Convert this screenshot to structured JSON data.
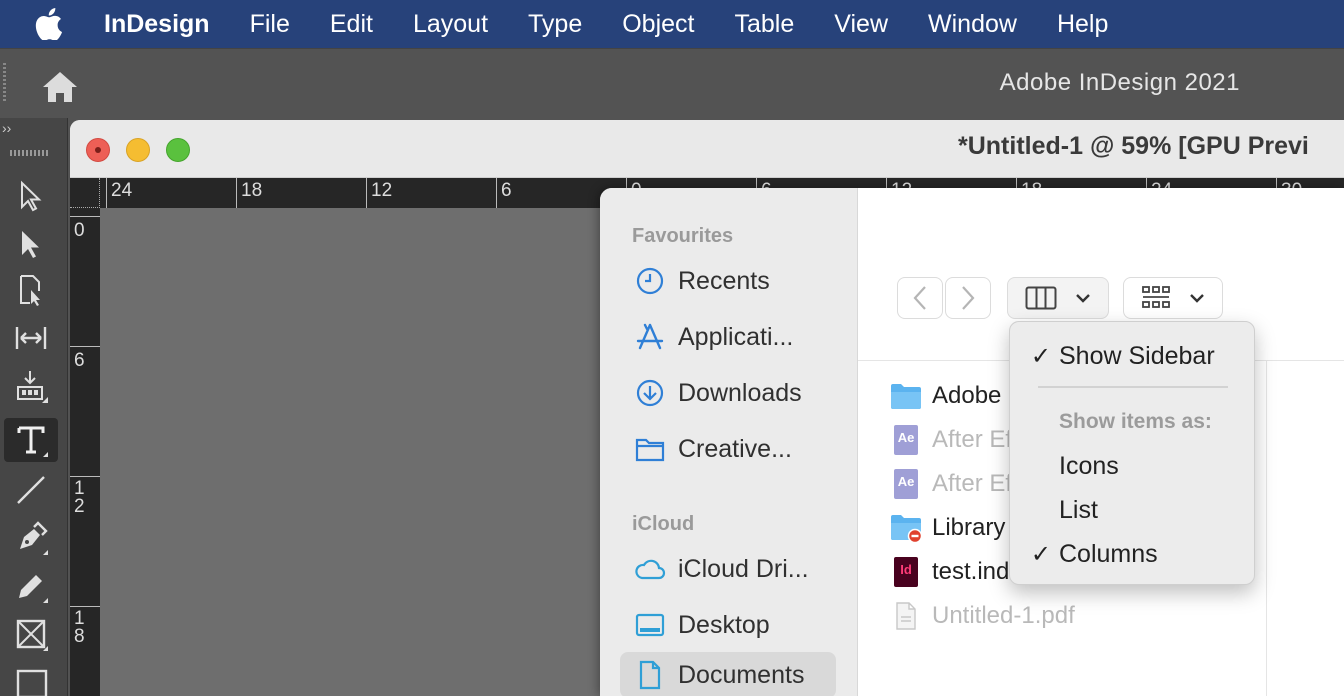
{
  "menubar": {
    "app_name": "InDesign",
    "items": [
      "File",
      "Edit",
      "Layout",
      "Type",
      "Object",
      "Table",
      "View",
      "Window",
      "Help"
    ]
  },
  "appbar": {
    "title": "Adobe InDesign 2021"
  },
  "tools": {
    "collapse_label": "››",
    "items": [
      "selection-tool",
      "direct-selection-tool",
      "page-tool",
      "gap-tool",
      "content-collector-tool",
      "type-tool",
      "line-tool",
      "pen-tool",
      "pencil-tool",
      "rectangle-frame-tool",
      "rectangle-tool"
    ],
    "active": "type-tool"
  },
  "document": {
    "title": "*Untitled-1 @ 59% [GPU Previ",
    "ruler_h_labels": [
      "24",
      "18",
      "12",
      "6",
      "0",
      "6",
      "12",
      "18",
      "24",
      "30"
    ],
    "ruler_v_labels": [
      "0",
      "6",
      "1\n2",
      "1\n8"
    ]
  },
  "dialog": {
    "sidebar": {
      "favourites_label": "Favourites",
      "favourites": [
        "Recents",
        "Applicati...",
        "Downloads",
        "Creative..."
      ],
      "icloud_label": "iCloud",
      "icloud": [
        "iCloud Dri...",
        "Desktop",
        "Documents"
      ],
      "selected": "Documents"
    },
    "files": [
      {
        "name": "Adobe",
        "type": "folder",
        "dim": false
      },
      {
        "name": "After Ef",
        "type": "aep",
        "dim": true,
        "badge": "Ae"
      },
      {
        "name": "After Ef",
        "type": "aep",
        "dim": true,
        "badge": "Ae"
      },
      {
        "name": "Library",
        "type": "folder-restricted",
        "dim": false
      },
      {
        "name": "test.ind",
        "type": "indd",
        "dim": false,
        "badge": "Id"
      },
      {
        "name": "Untitled-1.pdf",
        "type": "pdf",
        "dim": true
      }
    ],
    "view_menu": {
      "show_sidebar": "Show Sidebar",
      "header": "Show items as:",
      "icons": "Icons",
      "list": "List",
      "columns": "Columns",
      "checked": [
        "Show Sidebar",
        "Columns"
      ]
    }
  },
  "colors": {
    "menubar": "#27427a",
    "accent_blue": "#2f7fd6",
    "indd_red": "#49021f"
  }
}
